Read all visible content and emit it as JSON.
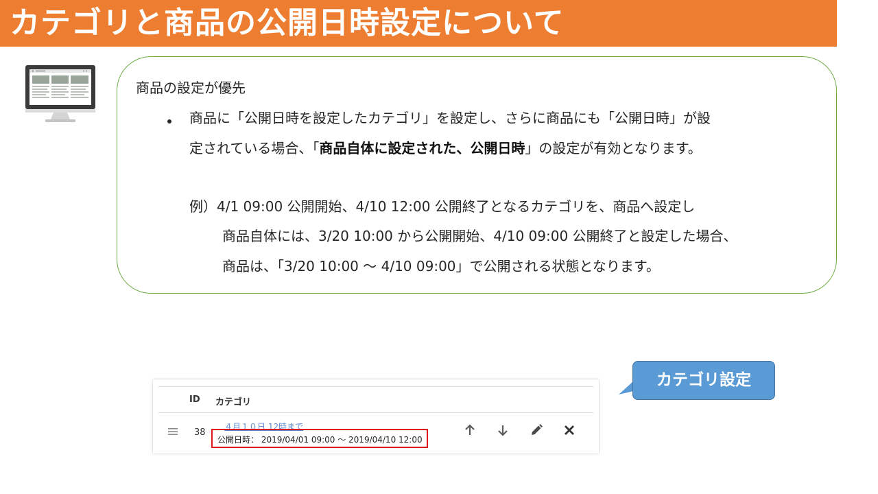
{
  "title": "カテゴリと商品の公開日時設定について",
  "info": {
    "heading": "商品の設定が優先",
    "bullet_line1": "商品に「公開日時を設定したカテゴリ」を設定し、さらに商品にも「公開日時」が設",
    "bullet_line2_pre": "定されている場合、「",
    "bullet_line2_bold": "商品自体に設定された、公開日時",
    "bullet_line2_post": "」の設定が有効となります。",
    "example_line1": "例）4/1 09:00 公開開始、4/10 12:00 公開終了となるカテゴリを、商品へ設定し",
    "example_line2": "商品自体には、3/20 10:00 から公開開始、4/10 09:00 公開終了と設定した場合、",
    "example_line3": "商品は、「3/20 10:00 ～ 4/10 09:00」で公開される状態となります。"
  },
  "screenshot": {
    "columns": [
      "ID",
      "カテゴリ"
    ],
    "row": {
      "id": "38",
      "category_link": "４月１０日 12時まで",
      "publish_label": "公開日時：",
      "publish_range": "2019/04/01 09:00 ～ 2019/04/10 12:00"
    },
    "actions": [
      "arrow-up-icon",
      "arrow-down-icon",
      "pencil-icon",
      "close-icon"
    ]
  },
  "callout": {
    "label": "カテゴリ設定"
  },
  "colors": {
    "title_bg": "#ed7d31",
    "box_border": "#70ad47",
    "callout_bg": "#5b9bd5",
    "highlight": "#e0161d",
    "link": "#5b8bd0"
  }
}
